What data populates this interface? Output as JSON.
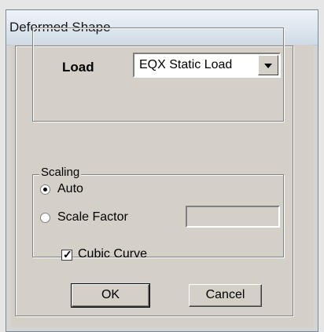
{
  "window": {
    "title": "Deformed Shape"
  },
  "load": {
    "label": "Load",
    "selected": "EQX Static Load"
  },
  "scaling": {
    "legend": "Scaling",
    "options": [
      {
        "label": "Auto",
        "checked": true
      },
      {
        "label": "Scale Factor",
        "checked": false
      }
    ],
    "scale_factor_value": ""
  },
  "cubic_curve": {
    "label": "Cubic Curve",
    "checked": true
  },
  "buttons": {
    "ok": "OK",
    "cancel": "Cancel"
  }
}
